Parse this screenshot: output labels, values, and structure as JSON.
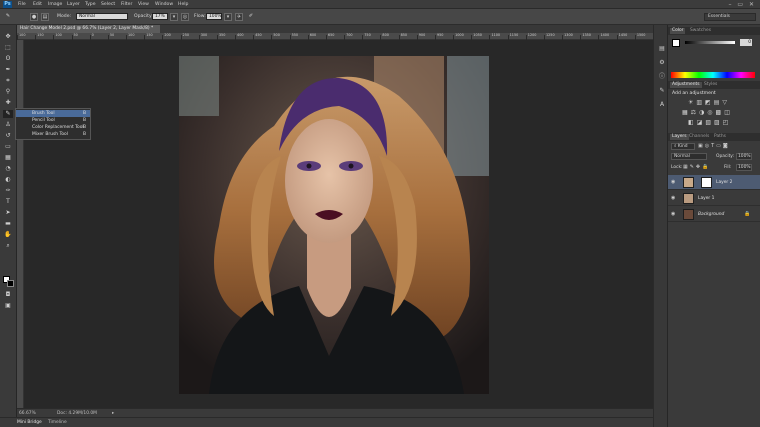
{
  "app": {
    "logo": "Ps"
  },
  "menu": [
    "File",
    "Edit",
    "Image",
    "Layer",
    "Type",
    "Select",
    "Filter",
    "View",
    "Window",
    "Help"
  ],
  "window_controls": "– ▭ ✕",
  "options_bar": {
    "mode_label": "Mode:",
    "mode_value": "Normal",
    "opacity_label": "Opacity:",
    "opacity_value": "17%",
    "flow_label": "Flow:",
    "flow_value": "100%",
    "workspace": "Essentials"
  },
  "document": {
    "tab_title": "Hair Change Model 2.psd @ 66.7% (Layer 2, Layer Mask/8) *",
    "ruler_marks": [
      "100",
      "150",
      "100",
      "50",
      "0",
      "50",
      "100",
      "150",
      "200",
      "250",
      "300",
      "350",
      "400",
      "450",
      "500",
      "550",
      "600",
      "650",
      "700",
      "750",
      "800",
      "850",
      "900",
      "950",
      "1000",
      "1050",
      "1100",
      "1150",
      "1200",
      "1250",
      "1300",
      "1350",
      "1400",
      "1450",
      "1500"
    ]
  },
  "tool_flyout": {
    "items": [
      {
        "label": "Brush Tool",
        "key": "B"
      },
      {
        "label": "Pencil Tool",
        "key": "B"
      },
      {
        "label": "Color Replacement Tool",
        "key": "B"
      },
      {
        "label": "Mixer Brush Tool",
        "key": "B"
      }
    ]
  },
  "status": {
    "zoom": "66.67%",
    "doc": "Doc: 4.29M/10.0M"
  },
  "bottom_tabs": [
    "Mini Bridge",
    "Timeline"
  ],
  "panels": {
    "color_tabs": [
      "Color",
      "Swatches"
    ],
    "color_value": "0",
    "adjust_tabs": [
      "Adjustments",
      "Styles"
    ],
    "adjust_title": "Add an adjustment",
    "layers_tabs": [
      "Layers",
      "Channels",
      "Paths"
    ],
    "kind_label": "Kind",
    "blend_mode": "Normal",
    "opacity_label": "Opacity:",
    "opacity_value": "100%",
    "lock_label": "Lock:",
    "fill_label": "Fill:",
    "fill_value": "100%",
    "layers": [
      "Layer 2",
      "Layer 1",
      "Background"
    ]
  },
  "colors": {
    "accent": "#0c4f8a",
    "selected_layer": "#4d5b72"
  }
}
